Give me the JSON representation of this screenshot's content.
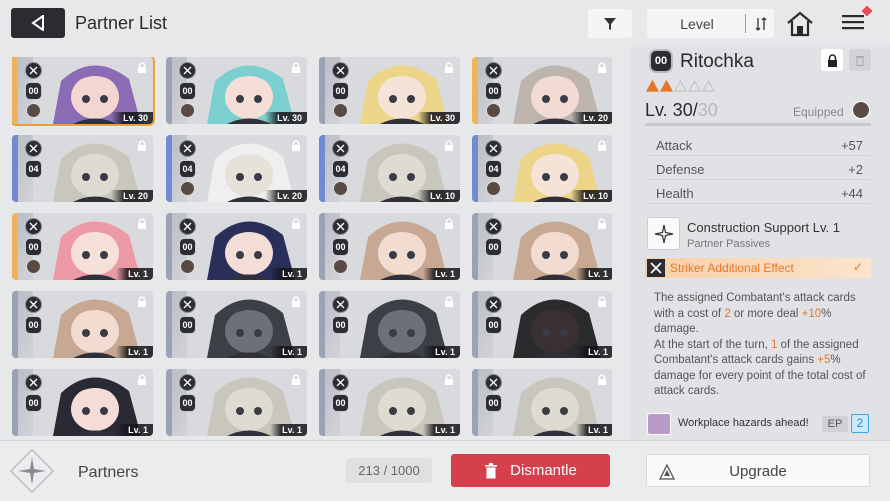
{
  "header": {
    "title": "Partner List",
    "sort_label": "Level"
  },
  "grid": {
    "cards": [
      {
        "rank": "00",
        "level": "Lv. 30",
        "hair": "#8b6bb3",
        "skin": "#f3d6cf",
        "stripe": "#f0b25a",
        "selected": true
      },
      {
        "rank": "00",
        "level": "Lv. 30",
        "hair": "#7ccfcf",
        "skin": "#f4ded7",
        "stripe": "#9aa3b6",
        "selected": false
      },
      {
        "rank": "00",
        "level": "Lv. 30",
        "hair": "#ecd489",
        "skin": "#f6e3d8",
        "stripe": "#9aa3b6",
        "selected": false
      },
      {
        "rank": "00",
        "level": "Lv. 20",
        "hair": "#bdb5ad",
        "skin": "#f1dbd2",
        "stripe": "#f0b25a",
        "selected": false
      },
      {
        "rank": "04",
        "level": "Lv. 20",
        "hair": "#c9c6bd",
        "skin": "#dedbd3",
        "stripe": "#6f8bd1",
        "selected": false
      },
      {
        "rank": "04",
        "level": "Lv. 20",
        "hair": "#efefef",
        "skin": "#e6e2da",
        "stripe": "#6f8bd1",
        "selected": false
      },
      {
        "rank": "04",
        "level": "Lv. 10",
        "hair": "#c9c6bd",
        "skin": "#dedbd3",
        "stripe": "#6f8bd1",
        "selected": false
      },
      {
        "rank": "04",
        "level": "Lv. 10",
        "hair": "#ecd489",
        "skin": "#f6e3d8",
        "stripe": "#6f8bd1",
        "selected": false
      },
      {
        "rank": "00",
        "level": "Lv. 1",
        "hair": "#ec9aa6",
        "skin": "#f7e0da",
        "stripe": "#f0b25a",
        "selected": false
      },
      {
        "rank": "00",
        "level": "Lv. 1",
        "hair": "#2a2f5a",
        "skin": "#f3ddd6",
        "stripe": "#9aa3b6",
        "selected": false
      },
      {
        "rank": "00",
        "level": "Lv. 1",
        "hair": "#c7a993",
        "skin": "#f2dcd2",
        "stripe": "#9aa3b6",
        "selected": false
      },
      {
        "rank": "00",
        "level": "Lv. 1",
        "hair": "#c7a993",
        "skin": "#f2dcd2",
        "stripe": "#9aa3b6",
        "selected": false
      },
      {
        "rank": "00",
        "level": "Lv. 1",
        "hair": "#c7a993",
        "skin": "#f2dcd2",
        "stripe": "#9aa3b6",
        "selected": false
      },
      {
        "rank": "00",
        "level": "Lv. 1",
        "hair": "#3c3f46",
        "skin": "#6d7078",
        "stripe": "#9aa3b6",
        "selected": false
      },
      {
        "rank": "00",
        "level": "Lv. 1",
        "hair": "#3c3f46",
        "skin": "#6d7078",
        "stripe": "#9aa3b6",
        "selected": false
      },
      {
        "rank": "00",
        "level": "Lv. 1",
        "hair": "#2b2b2e",
        "skin": "#3a3033",
        "stripe": "#9aa3b6",
        "selected": false
      },
      {
        "rank": "00",
        "level": "Lv. 1",
        "hair": "#2a2a35",
        "skin": "#f3ddd6",
        "stripe": "#9aa3b6",
        "selected": false
      },
      {
        "rank": "00",
        "level": "Lv. 1",
        "hair": "#c9c6bd",
        "skin": "#dedbd3",
        "stripe": "#9aa3b6",
        "selected": false
      },
      {
        "rank": "00",
        "level": "Lv. 1",
        "hair": "#c9c6bd",
        "skin": "#dedbd3",
        "stripe": "#9aa3b6",
        "selected": false
      },
      {
        "rank": "00",
        "level": "Lv. 1",
        "hair": "#c9c6bd",
        "skin": "#dedbd3",
        "stripe": "#9aa3b6",
        "selected": false
      }
    ]
  },
  "panel": {
    "rank": "00",
    "name": "Ritochka",
    "stars_filled": 2,
    "stars_total": 5,
    "level_current": "Lv. 30/",
    "level_max": "30",
    "equipped_label": "Equipped",
    "stats": [
      {
        "label": "Attack",
        "value": "+57"
      },
      {
        "label": "Defense",
        "value": "+2"
      },
      {
        "label": "Health",
        "value": "+44"
      }
    ],
    "passive_name": "Construction Support Lv. 1",
    "passive_sub": "Partner Passives",
    "effect_label": "Striker Additional Effect",
    "desc": {
      "p1": "The assigned Combatant's attack cards with a cost of ",
      "p1_hl1": "2",
      "p1b": " or more deal ",
      "p1_hl2": "+10",
      "p1c": "% damage.",
      "p2": "At the start of the turn, ",
      "p2_hl1": "1",
      "p2b": " of the assigned Combatant's attack cards gains ",
      "p2_hl2": "+5",
      "p2c": "% damage for every point of the total cost of attack cards."
    },
    "ep_text": "Workplace hazards ahead!",
    "ep_tag": "EP",
    "ep_num": "2"
  },
  "footer": {
    "title": "Partners",
    "count": "213 / 1000",
    "dismantle_label": "Dismantle",
    "upgrade_label": "Upgrade"
  },
  "colors": {
    "accent_orange": "#e4772a",
    "dismantle_red": "#d5404d",
    "selected_outline": "#e9a23b"
  }
}
